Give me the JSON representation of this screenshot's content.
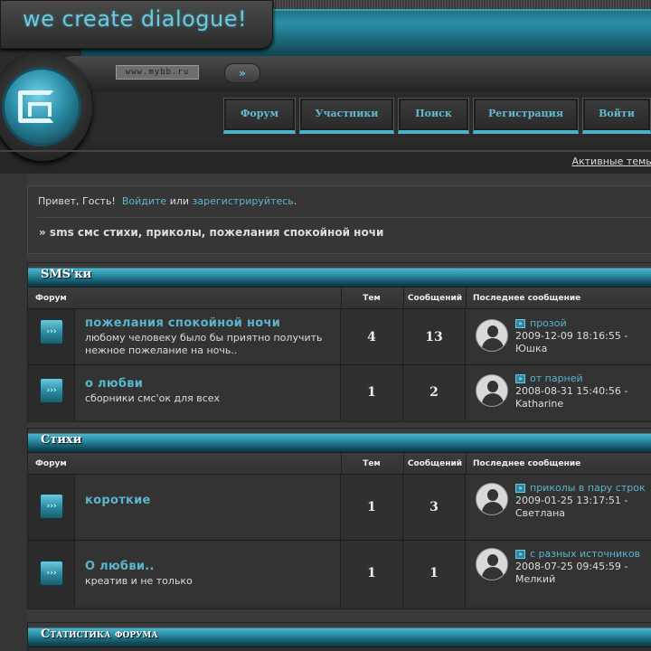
{
  "header": {
    "logo_text": "we create dialogue!",
    "url_text": "www.mybb.ru",
    "go_glyph": "»",
    "nav": [
      "Форум",
      "Участники",
      "Поиск",
      "Регистрация",
      "Войти"
    ],
    "active_topics": "Активные темы"
  },
  "welcome": {
    "greeting": "Привет, Гость!",
    "login_link": "Войдите",
    "or_text": "или",
    "register_link": "зарегистрируйтесь",
    "breadcrumb": "» sms смс стихи, приколы, пожелания спокойной ночи"
  },
  "columns": {
    "forum": "Форум",
    "topics": "Тем",
    "posts": "Сообщений",
    "last": "Последнее сообщение"
  },
  "categories": [
    {
      "title": "SMS'ки",
      "forums": [
        {
          "name": "пожелания спокойной ночи",
          "desc": "любому человеку было бы приятно получить нежное пожелание на ночь..",
          "topics": "4",
          "posts": "13",
          "last_topic": "прозой",
          "last_date": "2009-12-09 18:16:55",
          "last_author": "Юшка"
        },
        {
          "name": "о любви",
          "desc": "сборники смс'ок для всех",
          "topics": "1",
          "posts": "2",
          "last_topic": "от парней",
          "last_date": "2008-08-31 15:40:56",
          "last_author": "Katharine"
        }
      ]
    },
    {
      "title": "Стихи",
      "forums": [
        {
          "name": "короткие",
          "desc": "",
          "topics": "1",
          "posts": "3",
          "last_topic": "приколы в пару строк",
          "last_date": "2009-01-25 13:17:51",
          "last_author": "Светлана"
        },
        {
          "name": "О любви..",
          "desc": "креатив и не только",
          "topics": "1",
          "posts": "1",
          "last_topic": "с разных источников",
          "last_date": "2008-07-25 09:45:59",
          "last_author": "Мелкий"
        }
      ]
    },
    {
      "title": "Статистика форума"
    }
  ],
  "icons": {
    "forum": "forum-arrow-icon",
    "last_post": "go-to-post-icon",
    "avatar": "user-avatar-icon",
    "logo": "site-logo-icon"
  },
  "colors": {
    "accent": "#5ab6cc",
    "band": "#2a90a8",
    "background": "#353535"
  }
}
